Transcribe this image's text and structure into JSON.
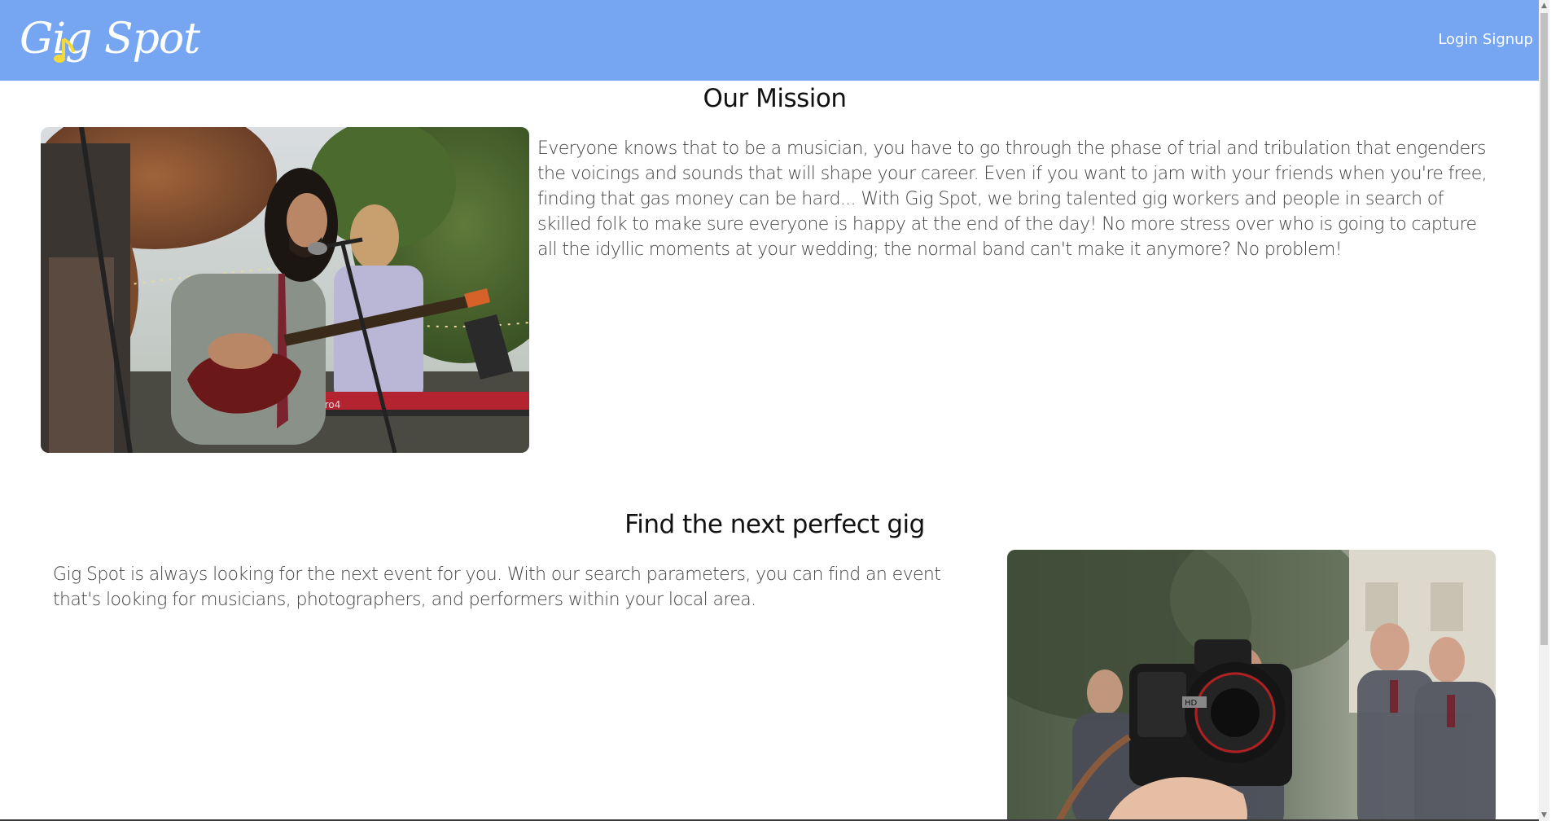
{
  "navbar": {
    "logo_text": "Gig Spot",
    "links": [
      {
        "label": "Login"
      },
      {
        "label": "Signup"
      }
    ],
    "background": "#76a6f2",
    "logo_accent": "#f5d83a"
  },
  "mission": {
    "title": "Our Mission",
    "text": "Everyone knows that to be a musician, you have to go through the phase of trial and tribulation that engenders the voicings and sounds that will shape your career. Even if you want to jam with your friends when you're free, finding that gas money can be hard... With Gig Spot, we bring talented gig workers and people in search of skilled folk to make sure everyone is happy at the end of the day! No more stress over who is going to capture all the idyllic moments at your wedding; the normal band can't make it anymore? No problem!",
    "image": "band-performing-photo"
  },
  "find_gig": {
    "title": "Find the next perfect gig",
    "text": "Gig Spot is always looking for the next event for you. With our search parameters, you can find an event that's looking for musicians, photographers, and performers within your local area.",
    "image": "wedding-camera-photo"
  }
}
